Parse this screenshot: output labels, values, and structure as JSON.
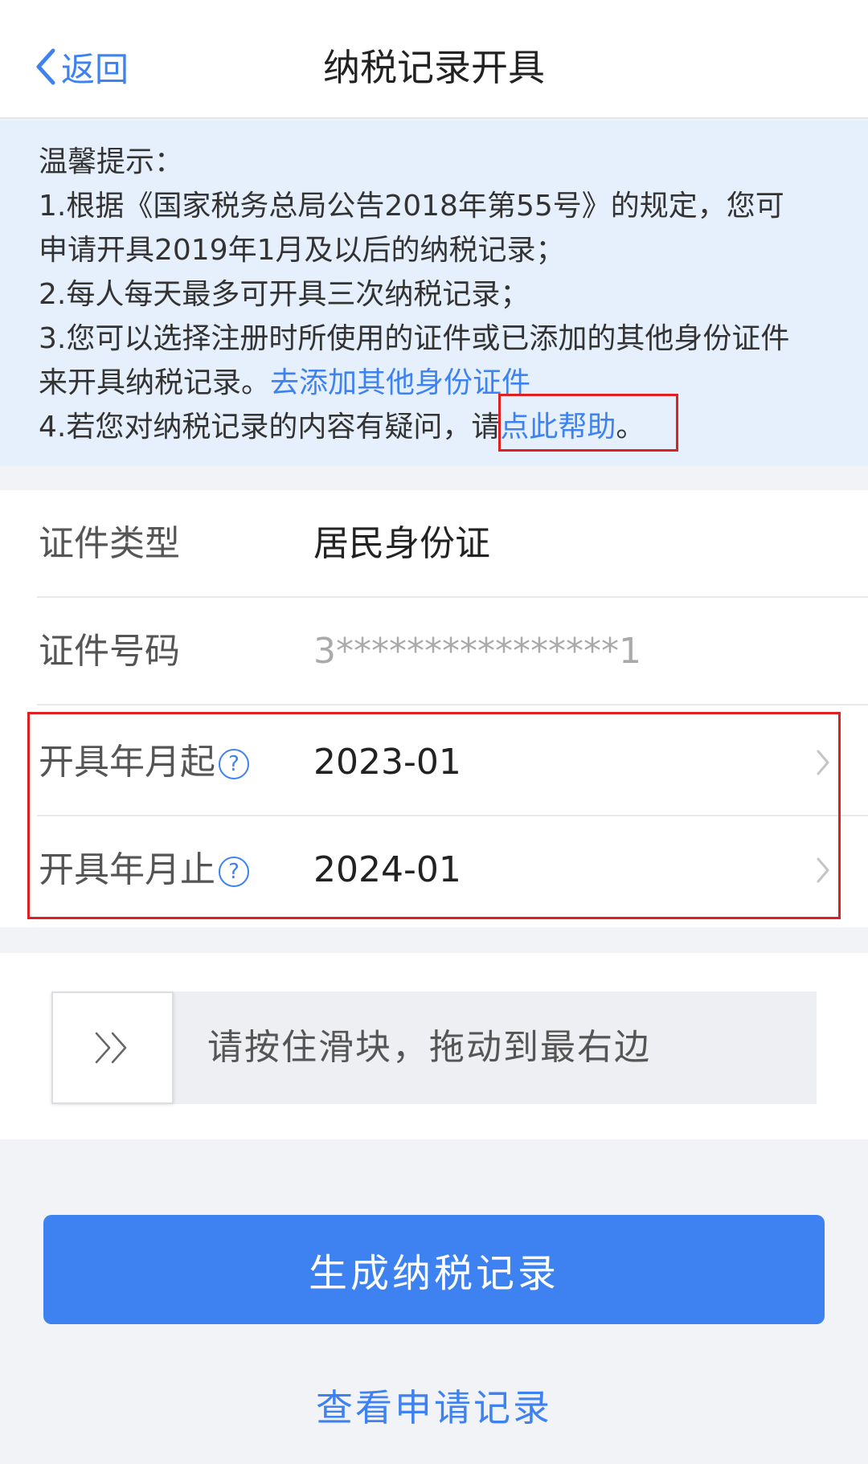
{
  "header": {
    "back_label": "返回",
    "title": "纳税记录开具"
  },
  "tips": {
    "heading": "温馨提示：",
    "line1": "1.根据《国家税务总局公告2018年第55号》的规定，您可",
    "line2": "申请开具2019年1月及以后的纳税记录；",
    "line3": "2.每人每天最多可开具三次纳税记录；",
    "line4": "3.您可以选择注册时所使用的证件或已添加的其他身份证件",
    "line5_prefix": "来开具纳税记录。",
    "line5_link": "去添加其他身份证件",
    "line6_prefix": "4.若您对纳税记录的内容有疑问，请",
    "line6_link": "点此帮助",
    "line6_suffix": "。"
  },
  "form": {
    "id_type": {
      "label": "证件类型",
      "value": "居民身份证"
    },
    "id_number": {
      "label": "证件号码",
      "value": "3****************1"
    },
    "start_month": {
      "label": "开具年月起",
      "value": "2023-01"
    },
    "end_month": {
      "label": "开具年月止",
      "value": "2024-01"
    },
    "help_glyph": "?"
  },
  "slider": {
    "handle_glyph": ">>",
    "text": "请按住滑块，拖动到最右边"
  },
  "actions": {
    "generate_label": "生成纳税记录",
    "view_records_label": "查看申请记录"
  },
  "colors": {
    "accent": "#3d82f0",
    "highlight_border": "#e02020",
    "tips_background": "#e6f0fc"
  }
}
